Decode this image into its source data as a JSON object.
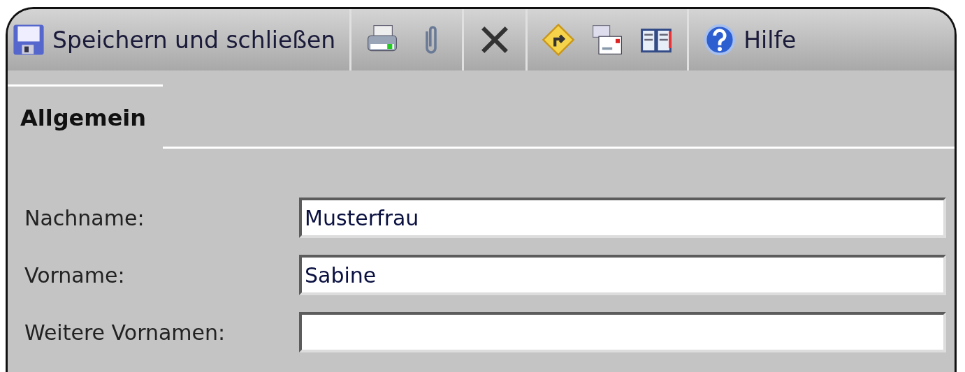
{
  "toolbar": {
    "save_label": "Speichern und schließen",
    "help_label": "Hilfe"
  },
  "tabs": [
    {
      "label": "Allgemein",
      "selected": true
    }
  ],
  "fields": [
    {
      "label": "Nachname:",
      "value": "Musterfrau"
    },
    {
      "label": "Vorname:",
      "value": "Sabine"
    },
    {
      "label": "Weitere Vornamen:"
    }
  ]
}
